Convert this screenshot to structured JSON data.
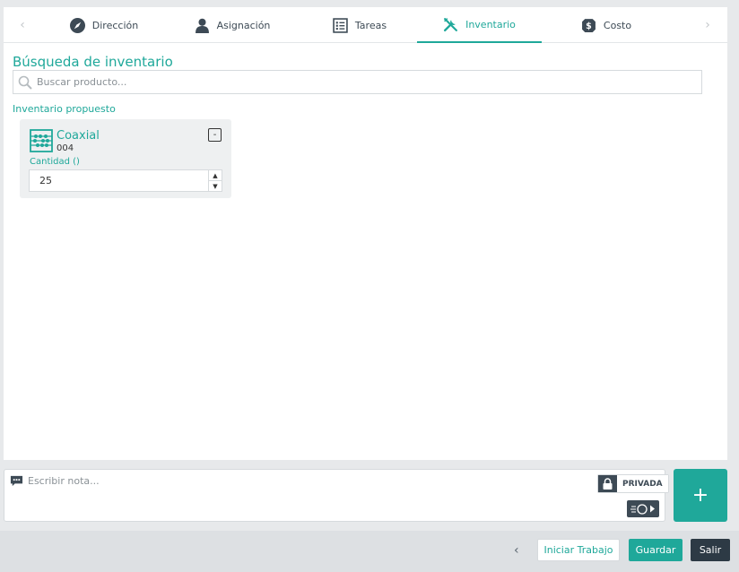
{
  "tabs": [
    {
      "label": "Dirección",
      "icon": "compass-icon"
    },
    {
      "label": "Asignación",
      "icon": "user-icon"
    },
    {
      "label": "Tareas",
      "icon": "checklist-icon"
    },
    {
      "label": "Inventario",
      "icon": "tools-icon",
      "active": true
    },
    {
      "label": "Costo",
      "icon": "dollar-icon"
    }
  ],
  "search": {
    "title": "Búsqueda de inventario",
    "placeholder": "Buscar producto..."
  },
  "proposed": {
    "title": "Inventario propuesto",
    "items": [
      {
        "name": "Coaxial",
        "code": "004",
        "quantity_label": "Cantidad ()",
        "quantity": "25",
        "remove_label": "-",
        "icon": "abacus-icon"
      }
    ]
  },
  "note": {
    "placeholder": "Escribir nota...",
    "private_label": "PRIVADA",
    "add_label": "+"
  },
  "footer": {
    "back_label": "‹",
    "start_label": "Iniciar Trabajo",
    "save_label": "Guardar",
    "exit_label": "Salir"
  },
  "colors": {
    "accent": "#1fa89a",
    "dark": "#3d4a55",
    "exit": "#2d3a45"
  }
}
